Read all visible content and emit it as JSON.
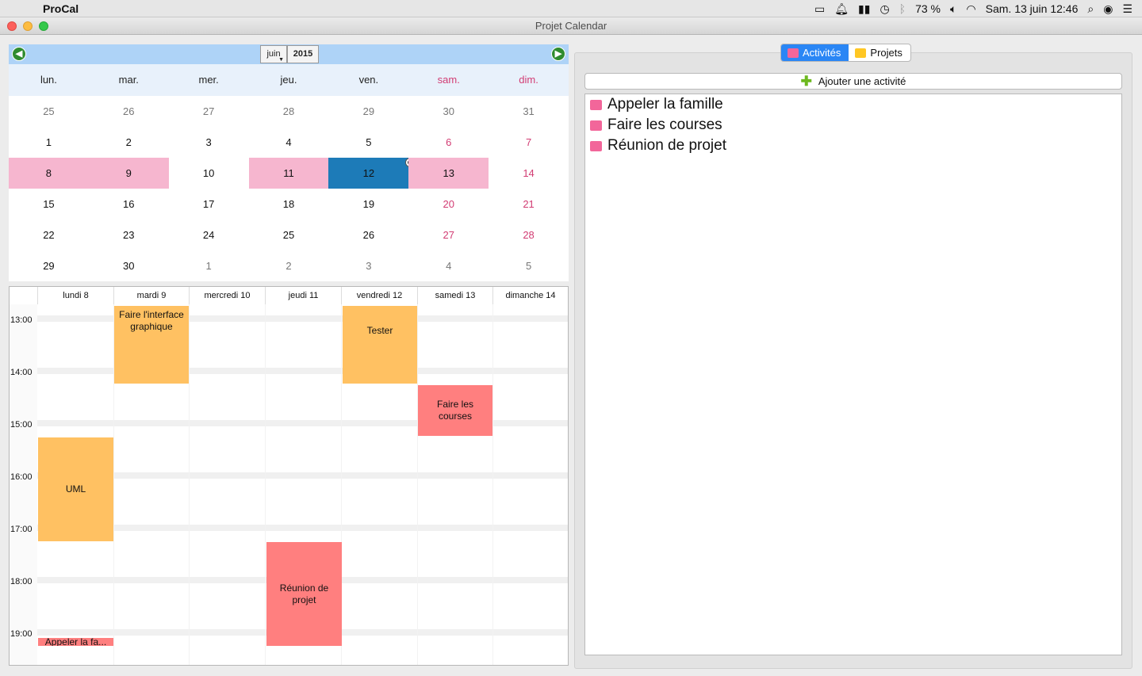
{
  "menubar": {
    "app_name": "ProCal",
    "battery": "73 %",
    "datetime": "Sam. 13 juin  12:46"
  },
  "window": {
    "title": "Projet Calendar"
  },
  "month_calendar": {
    "month": "juin",
    "year": "2015",
    "weekdays": [
      "lun.",
      "mar.",
      "mer.",
      "jeu.",
      "ven.",
      "sam.",
      "dim."
    ],
    "weeks": [
      [
        "25",
        "26",
        "27",
        "28",
        "29",
        "30",
        "31"
      ],
      [
        "1",
        "2",
        "3",
        "4",
        "5",
        "6",
        "7"
      ],
      [
        "8",
        "9",
        "10",
        "11",
        "12",
        "13",
        "14"
      ],
      [
        "15",
        "16",
        "17",
        "18",
        "19",
        "20",
        "21"
      ],
      [
        "22",
        "23",
        "24",
        "25",
        "26",
        "27",
        "28"
      ],
      [
        "29",
        "30",
        "1",
        "2",
        "3",
        "4",
        "5"
      ]
    ],
    "selected_day": "12"
  },
  "week_view": {
    "days": [
      "lundi 8",
      "mardi 9",
      "mercredi 10",
      "jeudi 11",
      "vendredi 12",
      "samedi 13",
      "dimanche 14"
    ],
    "hours": [
      "13:00",
      "14:00",
      "15:00",
      "16:00",
      "17:00",
      "18:00",
      "19:00"
    ],
    "events": [
      {
        "label": "Faire l'interface graphique",
        "day": "mardi 9",
        "color": "#ffc162"
      },
      {
        "label": "Tester",
        "day": "vendredi 12",
        "color": "#ffc162"
      },
      {
        "label": "Faire les courses",
        "day": "samedi 13",
        "color": "#ff7f7f"
      },
      {
        "label": "UML",
        "day": "lundi 8",
        "color": "#ffc162"
      },
      {
        "label": "Réunion de projet",
        "day": "jeudi 11",
        "color": "#ff7f7f"
      },
      {
        "label": "Appeler la fa...",
        "day": "lundi 8",
        "color": "#ff7f7f"
      }
    ]
  },
  "tabs": {
    "activities": "Activités",
    "projects": "Projets"
  },
  "add_activity_label": "Ajouter une activité",
  "activities": [
    "Appeler la famille",
    "Faire les courses",
    "Réunion de projet"
  ],
  "colors": {
    "accent": "#2a86f5",
    "selected_day": "#1d7bb8",
    "highlight_day": "#f6b6cf",
    "weekend": "#d23c73",
    "task": "#ffc162",
    "activity": "#ff7f7f"
  }
}
